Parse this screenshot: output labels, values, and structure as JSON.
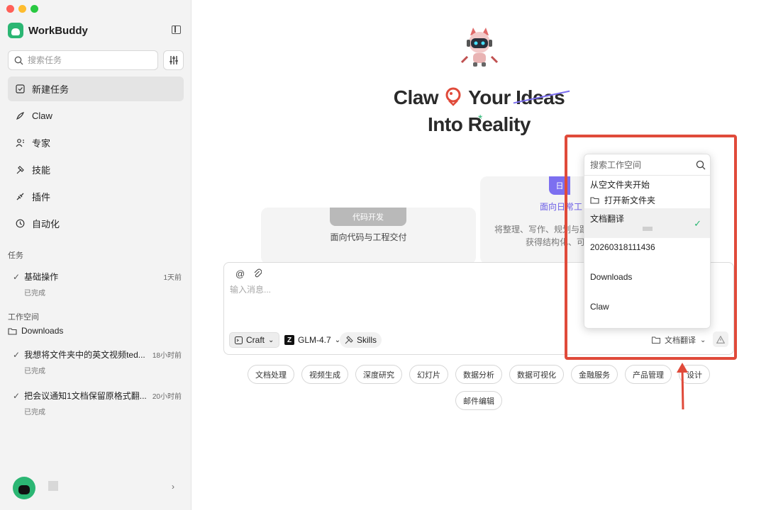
{
  "app": {
    "name": "WorkBuddy"
  },
  "sidebar": {
    "search_placeholder": "搜索任务",
    "nav": [
      {
        "label": "新建任务",
        "icon": "new-task-icon",
        "active": true
      },
      {
        "label": "Claw",
        "icon": "claw-icon",
        "active": false
      },
      {
        "label": "专家",
        "icon": "experts-icon",
        "active": false
      },
      {
        "label": "技能",
        "icon": "skills-icon",
        "active": false
      },
      {
        "label": "插件",
        "icon": "plugin-icon",
        "active": false
      },
      {
        "label": "自动化",
        "icon": "clock-icon",
        "active": false
      }
    ],
    "tasks_title": "任务",
    "tasks": [
      {
        "title": "基础操作",
        "time": "1天前",
        "status": "已完成"
      }
    ],
    "workspace_title": "工作空间",
    "workspace_folder": "Downloads",
    "workspace_tasks": [
      {
        "title": "我想将文件夹中的英文视频ted...",
        "time": "18小时前",
        "status": "已完成"
      },
      {
        "title": "把会议通知1文档保留原格式翻...",
        "time": "20小时前",
        "status": "已完成"
      }
    ]
  },
  "hero": {
    "line1_a": "Claw",
    "line1_b": "Your",
    "line1_c": "Ideas",
    "line2": "Into Reality"
  },
  "modes": {
    "left": {
      "tab": "代码开发",
      "desc": "面向代码与工程交付"
    },
    "right": {
      "tab": "日",
      "title": "面向日常工",
      "sub1": "将整理、写作、规划与跟",
      "sub2": "获得结构化、可"
    }
  },
  "composer": {
    "placeholder": "输入消息...",
    "mode_label": "Craft",
    "model_label": "GLM-4.7",
    "skills_label": "Skills",
    "workspace_label": "文档翻译"
  },
  "quick_actions": [
    "文档处理",
    "视频生成",
    "深度研究",
    "幻灯片",
    "数据分析",
    "数据可视化",
    "金融服务",
    "产品管理",
    "设计"
  ],
  "quick_actions_2": [
    "邮件编辑"
  ],
  "dropdown": {
    "search_placeholder": "搜索工作空间",
    "header": "从空文件夹开始",
    "open_new": "打开新文件夹",
    "items": [
      {
        "name": "文档翻译",
        "selected": true
      },
      {
        "name": "20260318111436",
        "selected": false
      },
      {
        "name": "Downloads",
        "selected": false
      },
      {
        "name": "Claw",
        "selected": false
      }
    ]
  },
  "colors": {
    "accent_green": "#2bb673",
    "accent_purple": "#7c6ff0",
    "highlight_red": "#e04a3a"
  }
}
